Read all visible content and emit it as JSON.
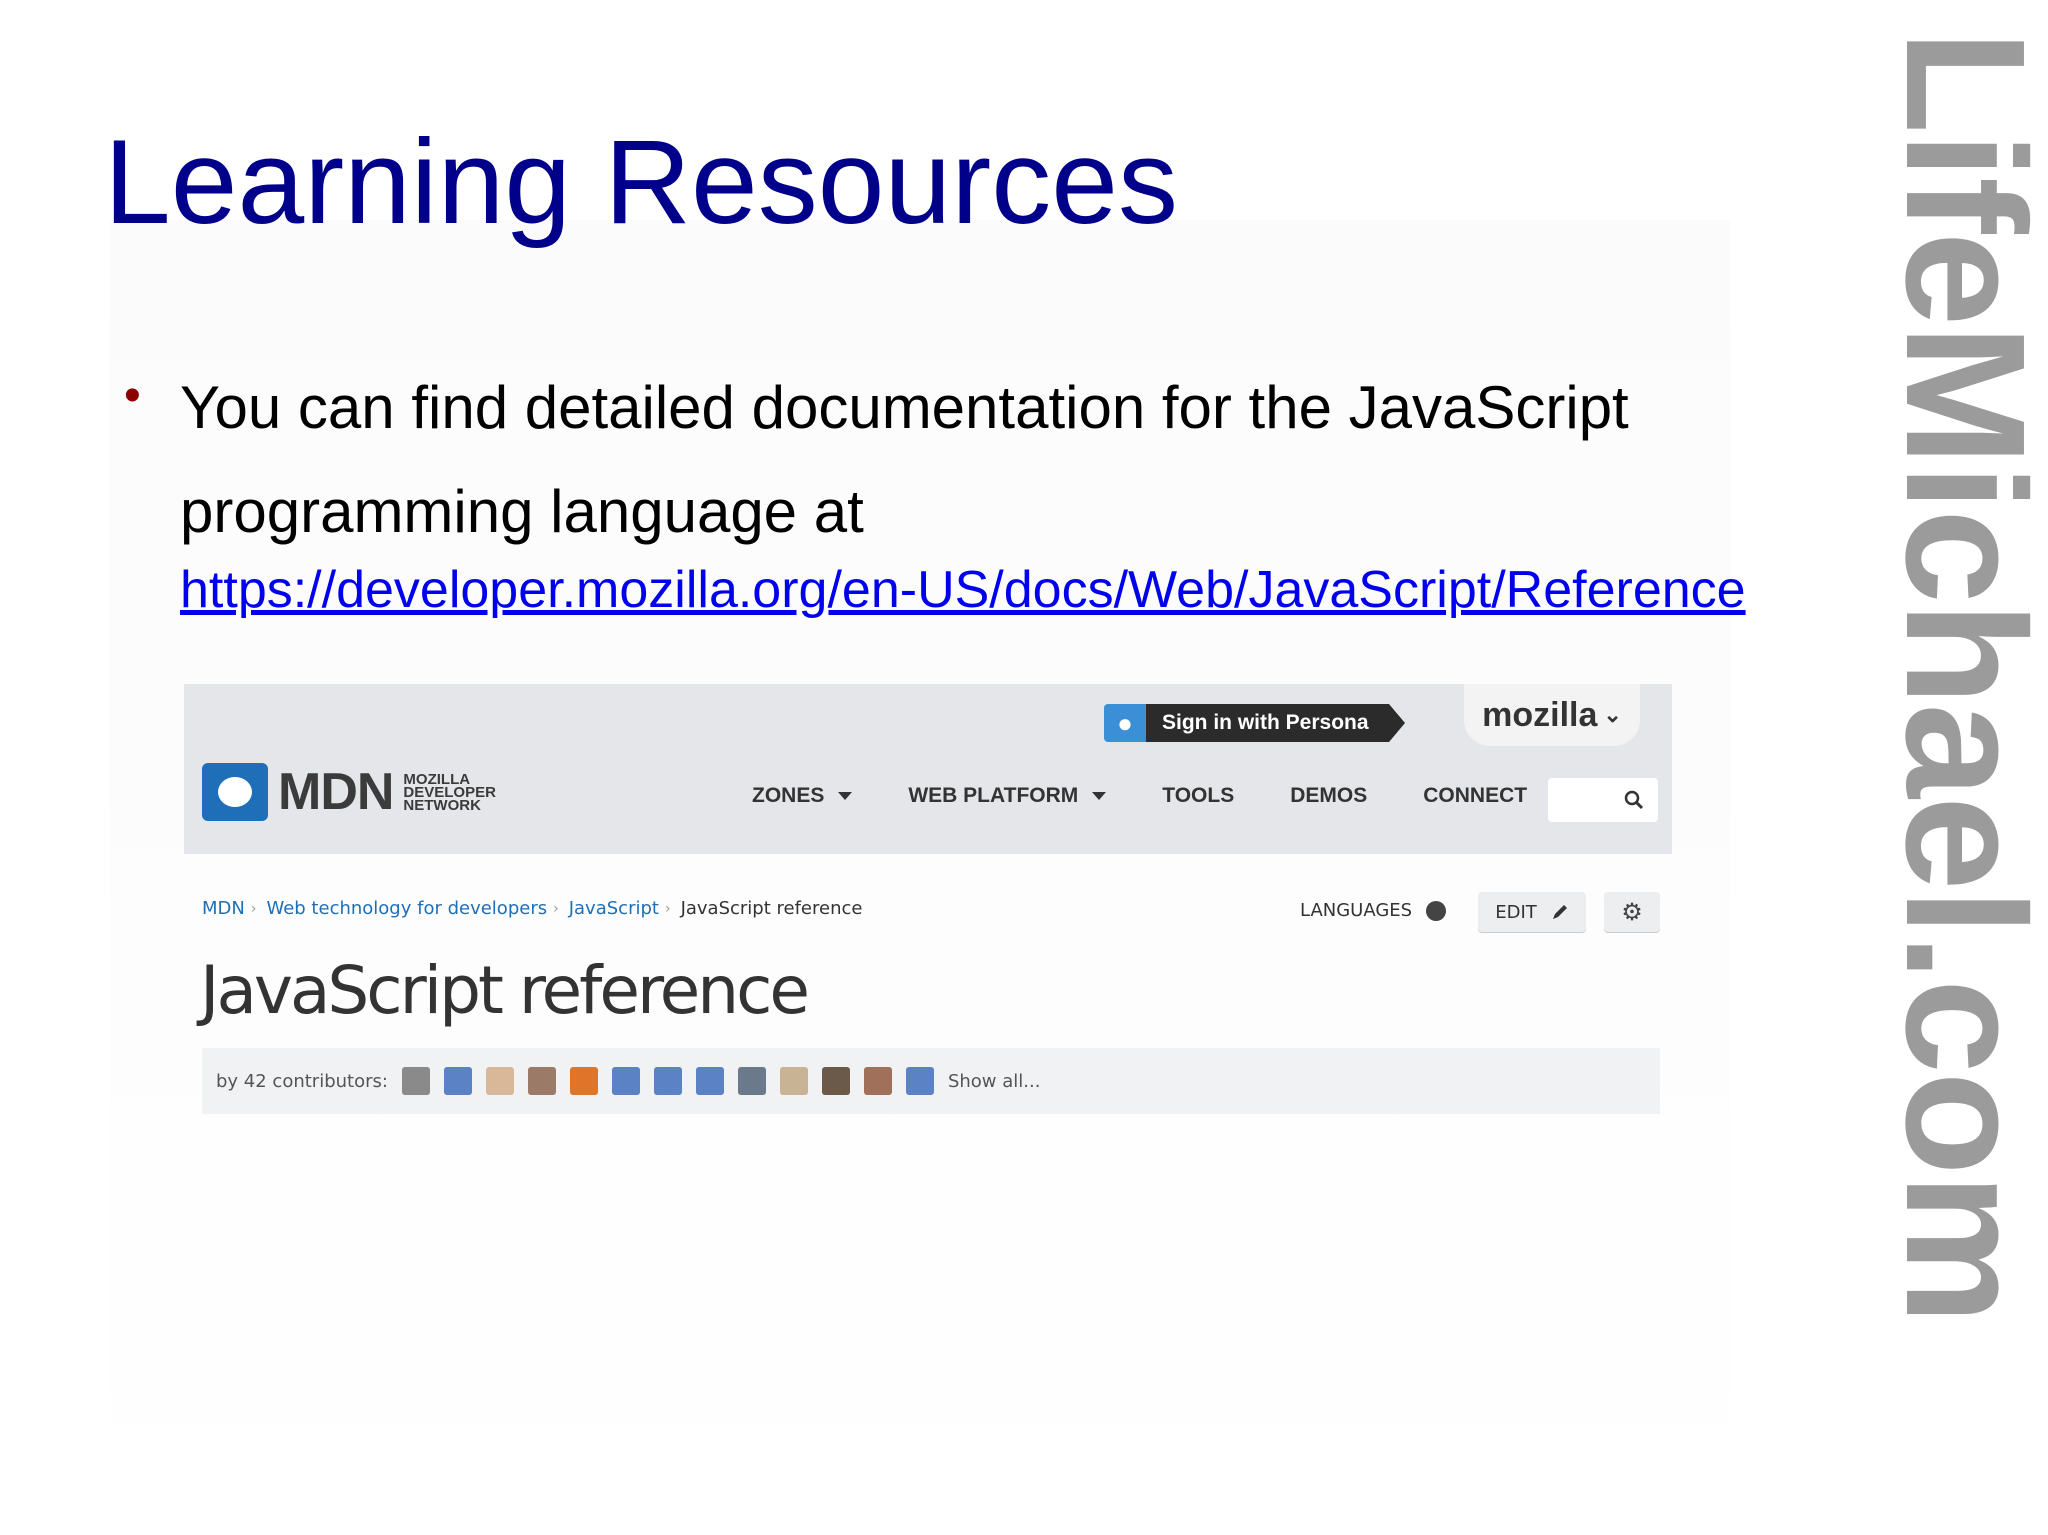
{
  "slide": {
    "title": "Learning Resources",
    "bullet_symbol": "•",
    "bullet_text": "You can find detailed documentation for the JavaScript programming language at",
    "link": "https://developer.mozilla.org/en-US/docs/Web/JavaScript/Reference",
    "side_brand": "LifeMichael.com"
  },
  "mdn": {
    "persona_label": "Sign in with Persona",
    "mozilla_label": "mozilla",
    "mozilla_chevron": "⌄",
    "logo_word": "MDN",
    "logo_sub": [
      "MOZILLA",
      "DEVELOPER",
      "NETWORK"
    ],
    "nav": [
      {
        "label": "ZONES",
        "caret": true
      },
      {
        "label": "WEB PLATFORM",
        "caret": true
      },
      {
        "label": "TOOLS",
        "caret": false
      },
      {
        "label": "DEMOS",
        "caret": false
      },
      {
        "label": "CONNECT",
        "caret": false
      }
    ],
    "breadcrumb": [
      "MDN",
      "Web technology for developers",
      "JavaScript"
    ],
    "breadcrumb_current": "JavaScript reference",
    "languages_label": "LANGUAGES",
    "edit_label": "EDIT",
    "page_title": "JavaScript reference",
    "contributors_label": "by 42 contributors:",
    "show_all_label": "Show all...",
    "avatar_colors": [
      "#8a8a8a",
      "#5a82c4",
      "#d9b89a",
      "#9b7a68",
      "#e0752a",
      "#5a82c4",
      "#5a82c4",
      "#5a82c4",
      "#6a7a8a",
      "#c8b494",
      "#6b5a4a",
      "#a0705a",
      "#5a82c4"
    ]
  },
  "colors": {
    "title": "#00008b",
    "bullet": "#8b0000",
    "link": "#0000ee",
    "brand": "#9b9b9b",
    "mdn_blue": "#1f6fb8",
    "persona_blue": "#3a8fd6"
  }
}
